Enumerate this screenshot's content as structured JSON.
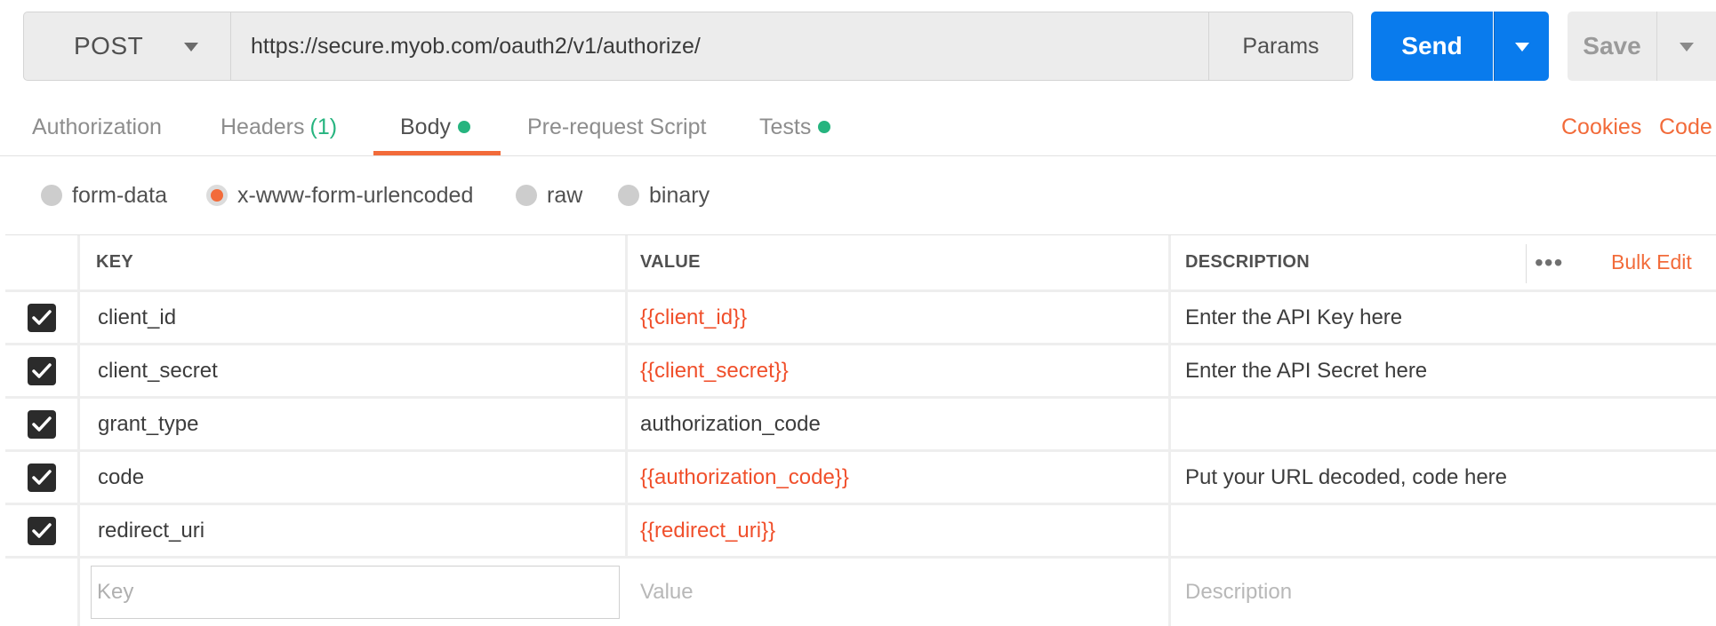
{
  "request": {
    "method": "POST",
    "url": "https://secure.myob.com/oauth2/v1/authorize/",
    "params_label": "Params",
    "send_label": "Send",
    "save_label": "Save"
  },
  "tabs": [
    {
      "label": "Authorization"
    },
    {
      "label": "Headers",
      "count": "(1)"
    },
    {
      "label": "Body",
      "active": true
    },
    {
      "label": "Pre-request Script"
    },
    {
      "label": "Tests"
    }
  ],
  "tab_links": {
    "cookies": "Cookies",
    "code": "Code"
  },
  "body_types": [
    {
      "label": "form-data",
      "selected": false
    },
    {
      "label": "x-www-form-urlencoded",
      "selected": true
    },
    {
      "label": "raw",
      "selected": false
    },
    {
      "label": "binary",
      "selected": false
    }
  ],
  "table": {
    "headers": {
      "key": "KEY",
      "value": "VALUE",
      "description": "DESCRIPTION"
    },
    "bulk_edit_label": "Bulk Edit",
    "rows": [
      {
        "checked": true,
        "key": "client_id",
        "value": "{{client_id}}",
        "value_is_variable": true,
        "description": "Enter the API Key here"
      },
      {
        "checked": true,
        "key": "client_secret",
        "value": "{{client_secret}}",
        "value_is_variable": true,
        "description": "Enter the API Secret here"
      },
      {
        "checked": true,
        "key": "grant_type",
        "value": "authorization_code",
        "value_is_variable": false,
        "description": ""
      },
      {
        "checked": true,
        "key": "code",
        "value": "{{authorization_code}}",
        "value_is_variable": true,
        "description": "Put your URL decoded, code here"
      },
      {
        "checked": true,
        "key": "redirect_uri",
        "value": "{{redirect_uri}}",
        "value_is_variable": true,
        "description": ""
      }
    ],
    "new_row": {
      "key_placeholder": "Key",
      "value_placeholder": "Value",
      "description_placeholder": "Description"
    }
  },
  "colors": {
    "accent": "#f26b3a",
    "send": "#097bed",
    "variable": "#f04f2b",
    "indicator": "#26b47f"
  }
}
